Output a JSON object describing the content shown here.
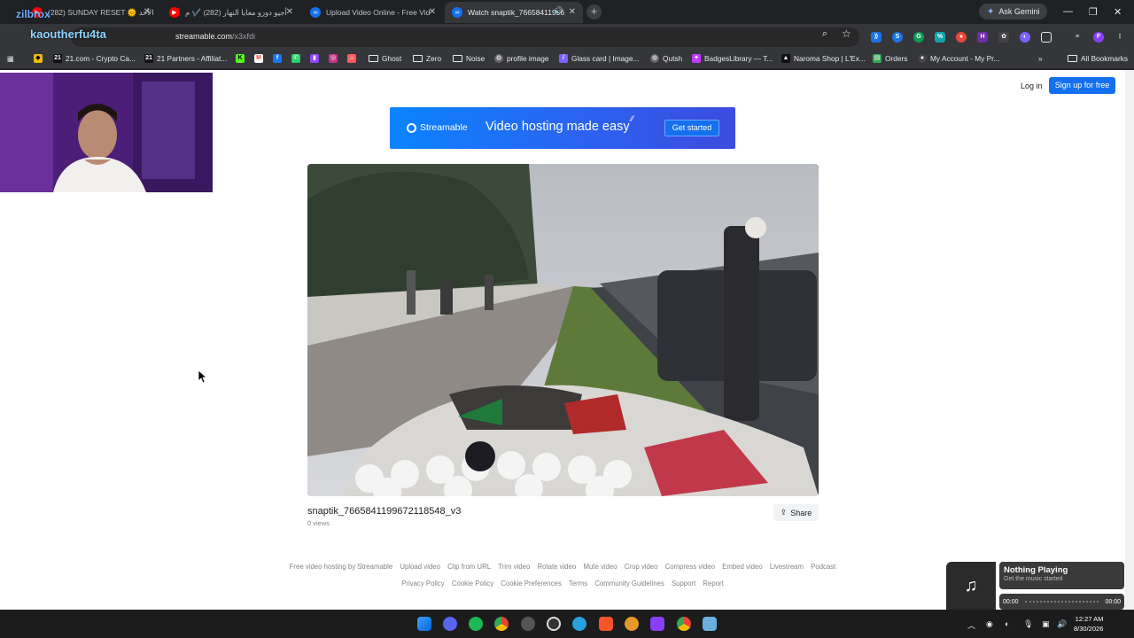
{
  "browser": {
    "tabs": [
      {
        "label": "(282) SUNDAY RESET 🌞 الأحد",
        "fav_color": "#ff0000"
      },
      {
        "label": "أجيو دوزو معايا النهار (282) ✔️ م",
        "fav_color": "#ff0000"
      },
      {
        "label": "Upload Video Online - Free Vid",
        "fav_color": "#1570ef"
      },
      {
        "label": "Watch snaptik_76658411996",
        "fav_color": "#1570ef",
        "active": true
      }
    ],
    "ask_gemini": "Ask Gemini",
    "url_host": "streamable.com",
    "url_path": "/x3xfdi",
    "bookmarks": [
      "21.com - Crypto Ca...",
      "21 Partners - Affiliat...",
      "Ghost",
      "Zero",
      "Noise",
      "profile image",
      "Glass card | Image...",
      "Qutsh",
      "BadgesLibrary — T...",
      "Naroma Shop | L'Ex...",
      "Orders",
      "My Account - My Pr..."
    ],
    "all_bookmarks": "All Bookmarks"
  },
  "stream_overlay": {
    "name1": "zilbrox",
    "name2": "kaoutherfu4ta"
  },
  "page": {
    "login": "Log in",
    "signup": "Sign up for free",
    "banner": {
      "brand": "Streamable",
      "tagline": "Video hosting made easy",
      "cta": "Get started"
    },
    "video_title": "snaptik_7665841199672118548_v3",
    "views": "0 views",
    "share": "Share",
    "footer_links_1": [
      "Free video hosting by Streamable",
      "Upload video",
      "Clip from URL",
      "Trim video",
      "Rotate video",
      "Mute video",
      "Crop video",
      "Compress video",
      "Embed video",
      "Livestream",
      "Podcast"
    ],
    "footer_links_2": [
      "Privacy Policy",
      "Cookie Policy",
      "Cookie Preferences",
      "Terms",
      "Community Guidelines",
      "Support",
      "Report"
    ]
  },
  "media_widget": {
    "title": "Nothing Playing",
    "subtitle": "Get the music started",
    "time_start": "00:00",
    "time_end": "00:00"
  },
  "taskbar": {
    "time": "12:27 AM",
    "date": "8/30/2026"
  }
}
